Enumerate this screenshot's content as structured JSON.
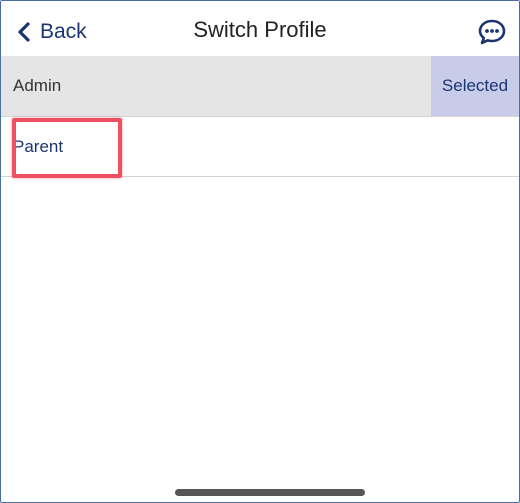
{
  "header": {
    "back_label": "Back",
    "title": "Switch Profile",
    "chat_icon": "chat-bubble-icon"
  },
  "profiles": [
    {
      "label": "Admin",
      "status": "Selected"
    },
    {
      "label": "Parent"
    }
  ],
  "colors": {
    "accent": "#1b3570",
    "selected_row_bg": "#e5e5e5",
    "selected_badge_bg": "#c9cce8",
    "highlight": "#f05060",
    "frame_border": "#4a6fa5"
  }
}
